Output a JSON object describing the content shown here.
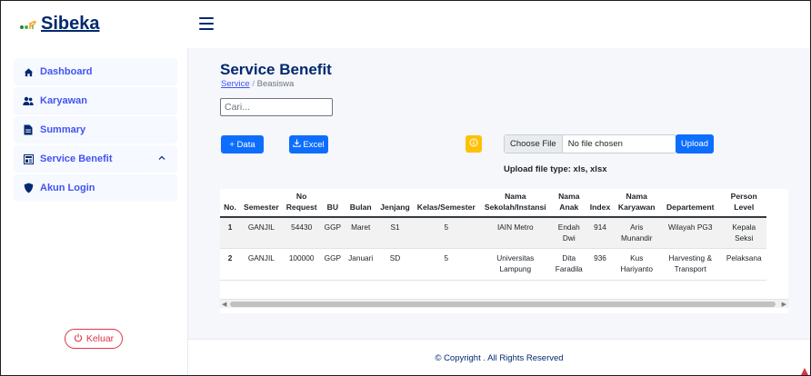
{
  "app": {
    "name": "Sibeka"
  },
  "sidebar": {
    "items": [
      {
        "label": "Dashboard",
        "icon": "home-icon"
      },
      {
        "label": "Karyawan",
        "icon": "users-icon"
      },
      {
        "label": "Summary",
        "icon": "file-icon"
      },
      {
        "label": "Service Benefit",
        "icon": "layout-icon"
      },
      {
        "label": "Akun Login",
        "icon": "shield-icon"
      }
    ],
    "logout_label": "Keluar"
  },
  "page": {
    "title": "Service Benefit",
    "breadcrumb": {
      "parent": "Service",
      "separator": "/",
      "current": "Beasiswa"
    }
  },
  "search": {
    "placeholder": "Cari..."
  },
  "toolbar": {
    "add_label": "+ Data",
    "excel_label": "Excel",
    "choose_file_label": "Choose File",
    "file_status": "No file chosen",
    "upload_label": "Upload",
    "upload_note": "Upload file type: xls, xlsx"
  },
  "table": {
    "columns": [
      "No.",
      "Semester",
      "No Request",
      "BU",
      "Bulan",
      "Jenjang",
      "Kelas/Semester",
      "Nama Sekolah/Instansi",
      "Nama Anak",
      "Index",
      "Nama Karyawan",
      "Departement",
      "Person Level"
    ],
    "rows": [
      [
        "1",
        "GANJIL",
        "54430",
        "GGP",
        "Maret",
        "S1",
        "5",
        "IAIN Metro",
        "Endah Dwi",
        "914",
        "Aris Munandir",
        "Wilayah PG3",
        "Kepala Seksi"
      ],
      [
        "2",
        "GANJIL",
        "100000",
        "GGP",
        "Januari",
        "SD",
        "5",
        "Universitas Lampung",
        "Dita Faradila",
        "936",
        "Kus Hariyanto",
        "Harvesting & Transport",
        "Pelaksana"
      ]
    ]
  },
  "footer": {
    "text": "© Copyright . All Rights Reserved"
  },
  "colors": {
    "brand": "#012970",
    "accent": "#4154f1",
    "primary_button": "#0d6efd",
    "warning": "#ffc107",
    "danger": "#dc3545"
  }
}
